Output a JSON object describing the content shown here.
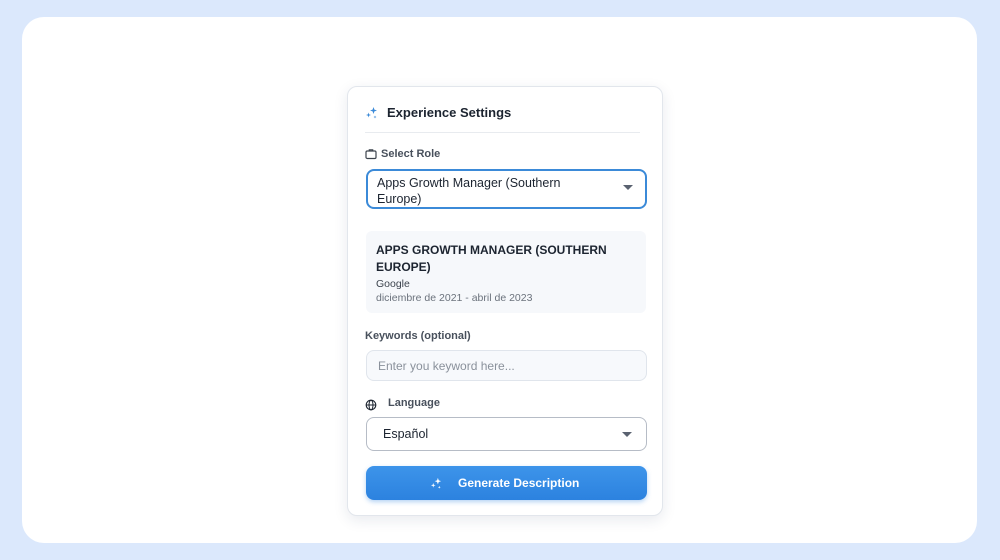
{
  "card": {
    "title": "Experience Settings",
    "icon": "sparkle-icon"
  },
  "role": {
    "label": "Select Role",
    "icon": "briefcase-icon",
    "selected": "Apps Growth Manager (Southern Europe)",
    "details": {
      "title": "APPS GROWTH MANAGER (SOUTHERN EUROPE)",
      "company": "Google",
      "dates": "diciembre de 2021 - abril de 2023"
    }
  },
  "keywords": {
    "label": "Keywords (optional)",
    "placeholder": "Enter you keyword here...",
    "value": ""
  },
  "language": {
    "label": "Language",
    "icon": "globe-icon",
    "selected": "Español"
  },
  "generate": {
    "label": "Generate Description",
    "icon": "sparkle-icon"
  },
  "colors": {
    "accent": "#3b8ad8",
    "button": "#2c82df",
    "background": "#dbe8fc"
  }
}
